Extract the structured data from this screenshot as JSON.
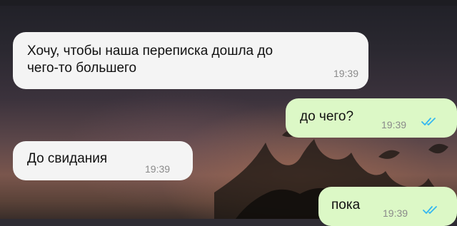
{
  "messages": [
    {
      "direction": "incoming",
      "text": "Хочу, чтобы наша переписка дошла до\nчего-то большего",
      "time": "19:39"
    },
    {
      "direction": "outgoing",
      "text": "до чего?",
      "time": "19:39",
      "status_icon": "double-check-icon"
    },
    {
      "direction": "incoming",
      "text": "До свидания",
      "time": "19:39"
    },
    {
      "direction": "outgoing",
      "text": "пока",
      "time": "19:39",
      "status_icon": "double-check-icon"
    }
  ],
  "colors": {
    "incoming_bubble": "#f4f4f4",
    "outgoing_bubble": "#dcf8c6",
    "read_ticks": "#34b7f1",
    "timestamp": "#8a8a8a"
  }
}
